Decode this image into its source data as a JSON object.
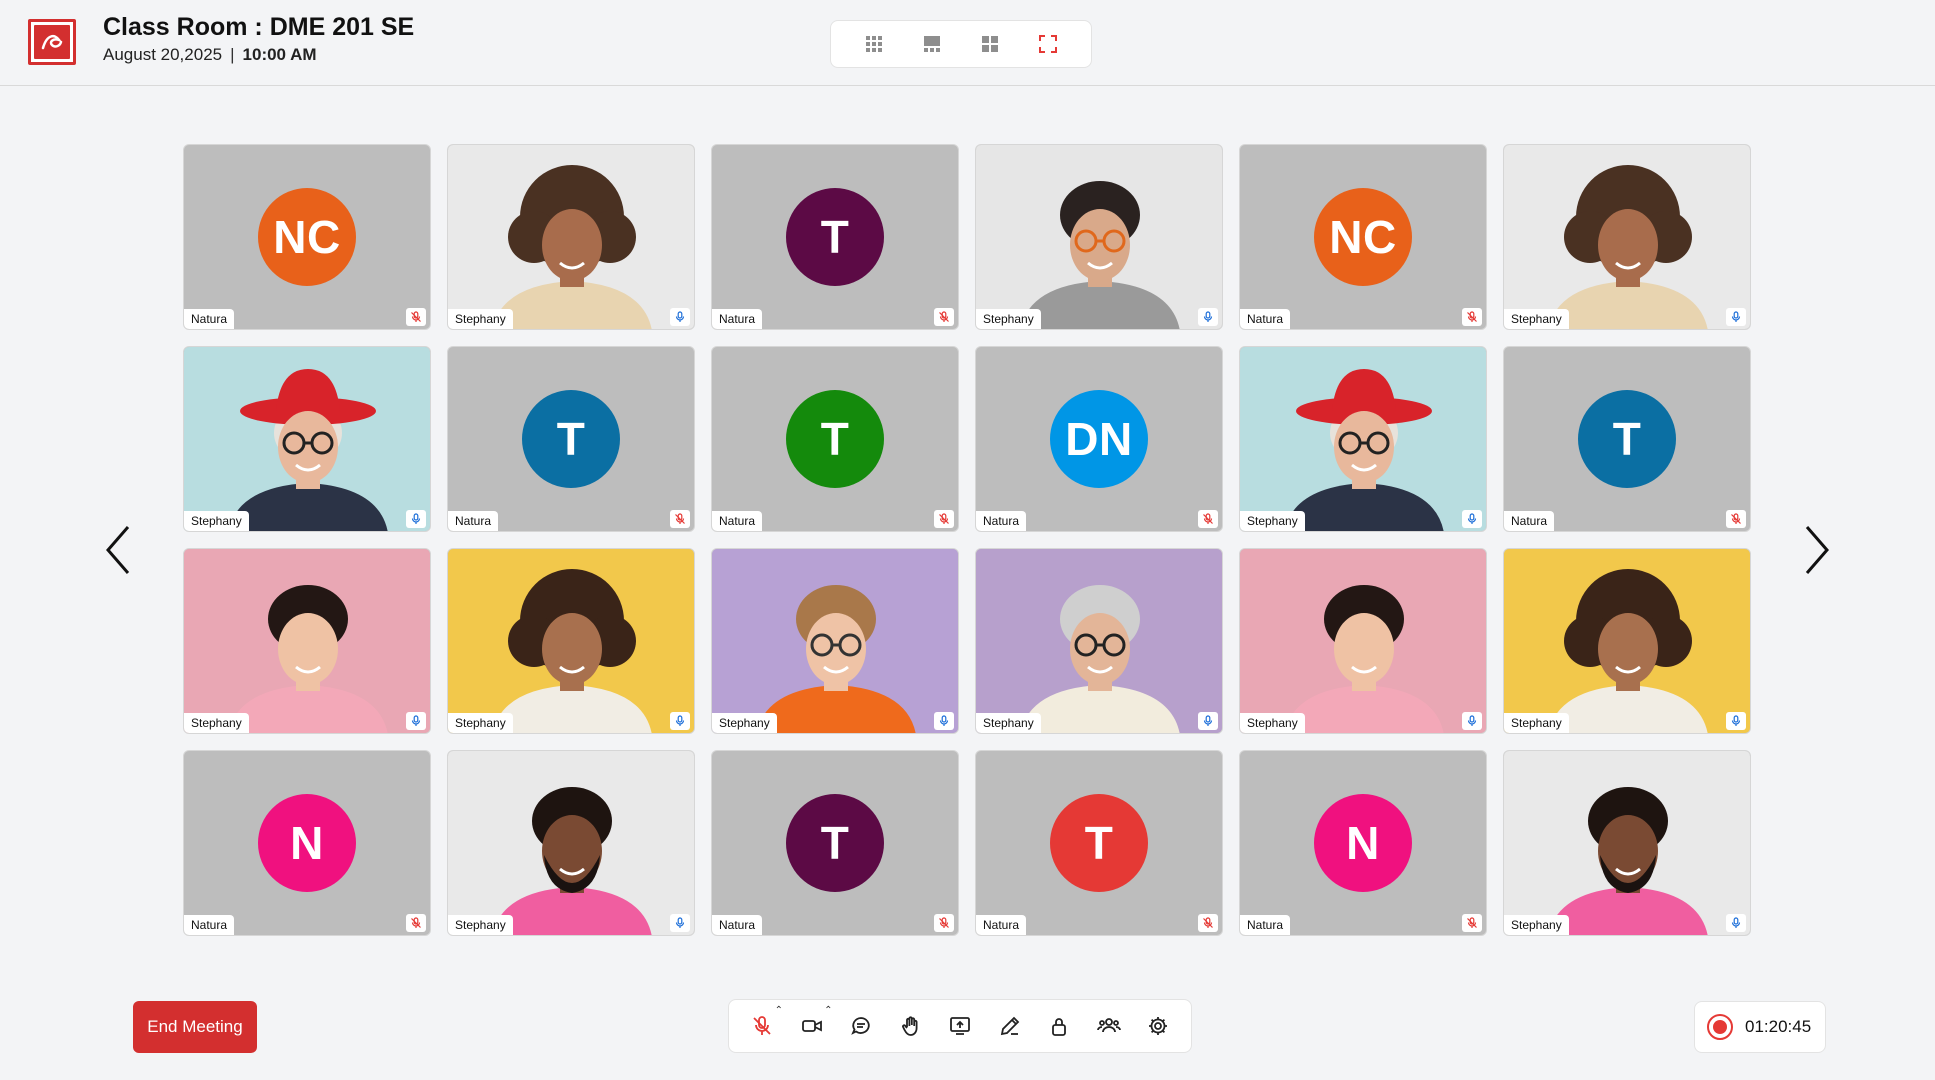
{
  "header": {
    "title": "Class Room : DME 201 SE",
    "date": "August 20,2025",
    "separator": "|",
    "time": "10:00 AM"
  },
  "layout_switch": [
    "grid-small-icon",
    "grid-spotlight-icon",
    "grid-large-icon",
    "fullscreen-icon"
  ],
  "colors": {
    "accent": "#d32f2f",
    "tile_bg": "#bdbdbd",
    "mic_on": "#1e6fd9",
    "mic_off": "#e53935"
  },
  "participants": [
    {
      "name": "Natura",
      "initials": "NC",
      "color": "#e8611a",
      "mic": "off"
    },
    {
      "name": "Stephany",
      "photo": "curly-hair-fingers-crossed",
      "mic": "on"
    },
    {
      "name": "Natura",
      "initials": "T",
      "color": "#5c0a45",
      "mic": "off"
    },
    {
      "name": "Stephany",
      "photo": "man-orange-glasses",
      "mic": "on"
    },
    {
      "name": "Natura",
      "initials": "NC",
      "color": "#e8611a",
      "mic": "off"
    },
    {
      "name": "Stephany",
      "photo": "curly-hair-fingers-crossed",
      "mic": "on"
    },
    {
      "name": "Stephany",
      "photo": "woman-red-hat-phone",
      "mic": "on"
    },
    {
      "name": "Natura",
      "initials": "T",
      "color": "#0b6fa3",
      "mic": "off"
    },
    {
      "name": "Natura",
      "initials": "T",
      "color": "#148a0c",
      "mic": "off"
    },
    {
      "name": "Natura",
      "initials": "DN",
      "color": "#0096e6",
      "mic": "off"
    },
    {
      "name": "Stephany",
      "photo": "woman-red-hat-phone",
      "mic": "on"
    },
    {
      "name": "Natura",
      "initials": "T",
      "color": "#0b6fa3",
      "mic": "off"
    },
    {
      "name": "Stephany",
      "photo": "woman-pink-background",
      "mic": "on"
    },
    {
      "name": "Stephany",
      "photo": "woman-yellow-background",
      "mic": "on"
    },
    {
      "name": "Stephany",
      "photo": "man-round-glasses-purple",
      "mic": "on"
    },
    {
      "name": "Stephany",
      "photo": "older-man-glasses-purple",
      "mic": "on"
    },
    {
      "name": "Stephany",
      "photo": "woman-pink-background",
      "mic": "on"
    },
    {
      "name": "Stephany",
      "photo": "woman-yellow-background",
      "mic": "on"
    },
    {
      "name": "Natura",
      "initials": "N",
      "color": "#f0117f",
      "mic": "off"
    },
    {
      "name": "Stephany",
      "photo": "bearded-man-pink-shirt",
      "mic": "on"
    },
    {
      "name": "Natura",
      "initials": "T",
      "color": "#5c0a45",
      "mic": "off"
    },
    {
      "name": "Natura",
      "initials": "T",
      "color": "#e53935",
      "mic": "off"
    },
    {
      "name": "Natura",
      "initials": "N",
      "color": "#f0117f",
      "mic": "off"
    },
    {
      "name": "Stephany",
      "photo": "bearded-man-pink-shirt",
      "mic": "on"
    }
  ],
  "footer": {
    "end_meeting_label": "End Meeting",
    "toolbar": [
      "mic-off-icon",
      "video-icon",
      "chat-icon",
      "raise-hand-icon",
      "share-screen-icon",
      "annotate-icon",
      "lock-icon",
      "participants-icon",
      "settings-icon"
    ],
    "recording_time": "01:20:45"
  }
}
